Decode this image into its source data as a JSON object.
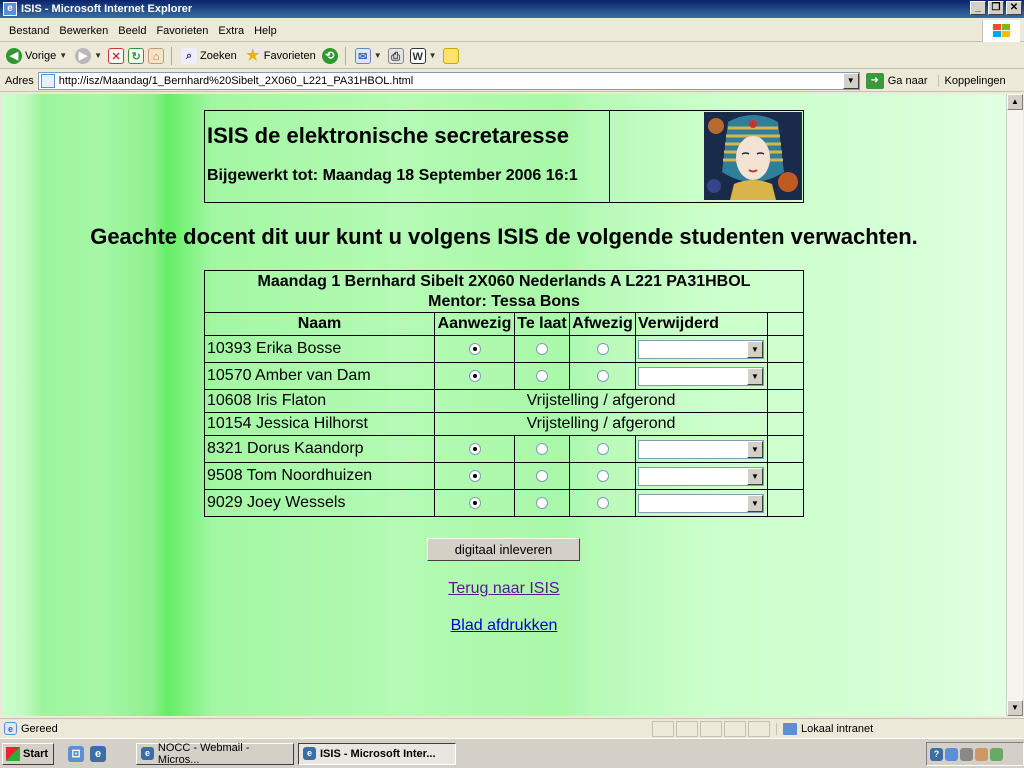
{
  "window": {
    "title": "ISIS - Microsoft Internet Explorer",
    "controls": [
      "minimize",
      "restore",
      "close"
    ]
  },
  "menu": [
    "Bestand",
    "Bewerken",
    "Beeld",
    "Favorieten",
    "Extra",
    "Help"
  ],
  "toolbar": {
    "back_label": "Vorige",
    "search_label": "Zoeken",
    "favorites_label": "Favorieten"
  },
  "address": {
    "label": "Adres",
    "url": "http://isz/Maandag/1_Bernhard%20Sibelt_2X060_L221_PA31HBOL.html",
    "go_label": "Ga naar",
    "links_label": "Koppelingen"
  },
  "page": {
    "title": "ISIS de elektronische secretaresse",
    "updated": "Bijgewerkt tot: Maandag 18 September 2006 16:1",
    "greeting": "Geachte docent dit uur kunt u volgens ISIS de volgende studenten verwachten.",
    "table_caption_line1": "Maandag 1 Bernhard Sibelt 2X060 Nederlands A L221 PA31HBOL",
    "table_caption_line2": "Mentor: Tessa Bons",
    "columns": [
      "Naam",
      "Aanwezig",
      "Te laat",
      "Afwezig",
      "Verwijderd"
    ],
    "students": [
      {
        "name": "10393 Erika Bosse",
        "status": "Aanwezig",
        "exempt": false
      },
      {
        "name": "10570 Amber van Dam",
        "status": "Aanwezig",
        "exempt": false
      },
      {
        "name": "10608 Iris Flaton",
        "exempt": true,
        "exempt_text": "Vrijstelling / afgerond"
      },
      {
        "name": "10154 Jessica Hilhorst",
        "exempt": true,
        "exempt_text": "Vrijstelling / afgerond"
      },
      {
        "name": "8321 Dorus Kaandorp",
        "status": "Aanwezig",
        "exempt": false
      },
      {
        "name": "9508 Tom Noordhuizen",
        "status": "Aanwezig",
        "exempt": false
      },
      {
        "name": "9029 Joey Wessels",
        "status": "Aanwezig",
        "exempt": false
      }
    ],
    "submit_label": "digitaal inleveren",
    "link_back": "Terug naar ISIS",
    "link_print": "Blad afdrukken"
  },
  "status": {
    "text": "Gereed",
    "zone": "Lokaal intranet"
  },
  "taskbar": {
    "start_label": "Start",
    "tasks": [
      "NOCC - Webmail - Micros...",
      "ISIS - Microsoft Inter..."
    ]
  }
}
